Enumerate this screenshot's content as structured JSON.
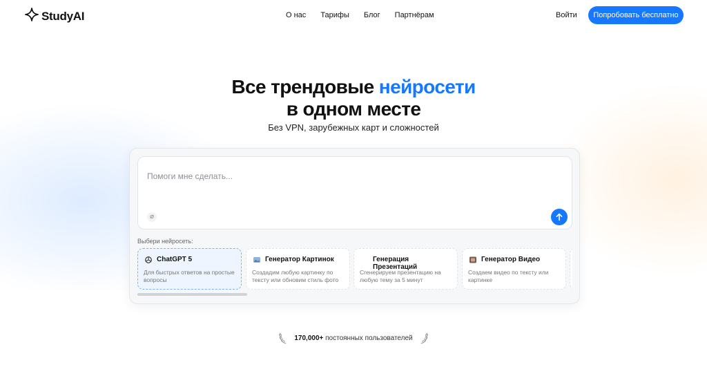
{
  "header": {
    "brand": "StudyAI",
    "nav": [
      "О нас",
      "Тарифы",
      "Блог",
      "Партнёрам"
    ],
    "login_label": "Войти",
    "cta_label": "Попробовать бесплатно"
  },
  "hero": {
    "title_part1": "Все трендовые",
    "title_accent": "нейросети",
    "title_line2": "в одном месте",
    "subtitle": "Без VPN, зарубежных карт и сложностей"
  },
  "prompt": {
    "placeholder": "Помоги мне сделать...",
    "attach_icon": "paperclip-icon",
    "send_icon": "arrow-up-icon"
  },
  "models": {
    "label": "Выбери нейросеть:",
    "items": [
      {
        "name": "ChatGPT 5",
        "desc": "Для быстрых ответов на простые вопросы",
        "icon": "openai-icon",
        "active": true
      },
      {
        "name": "Генератор Картинок",
        "desc": "Создадим любую картинку по тексту или обновим стиль фото",
        "icon": "image-icon",
        "active": false
      },
      {
        "name": "Генерация Презентаций",
        "desc": "Сгенерируем презентацию  на любую тему за 5 минут",
        "icon": "",
        "active": false
      },
      {
        "name": "Генератор Видео",
        "desc": "Создаем видео по тексту или картинке",
        "icon": "video-icon",
        "active": false
      }
    ]
  },
  "proof": {
    "count": "170,000+",
    "text": "постоянных пользователей"
  },
  "colors": {
    "accent": "#1677ff"
  }
}
